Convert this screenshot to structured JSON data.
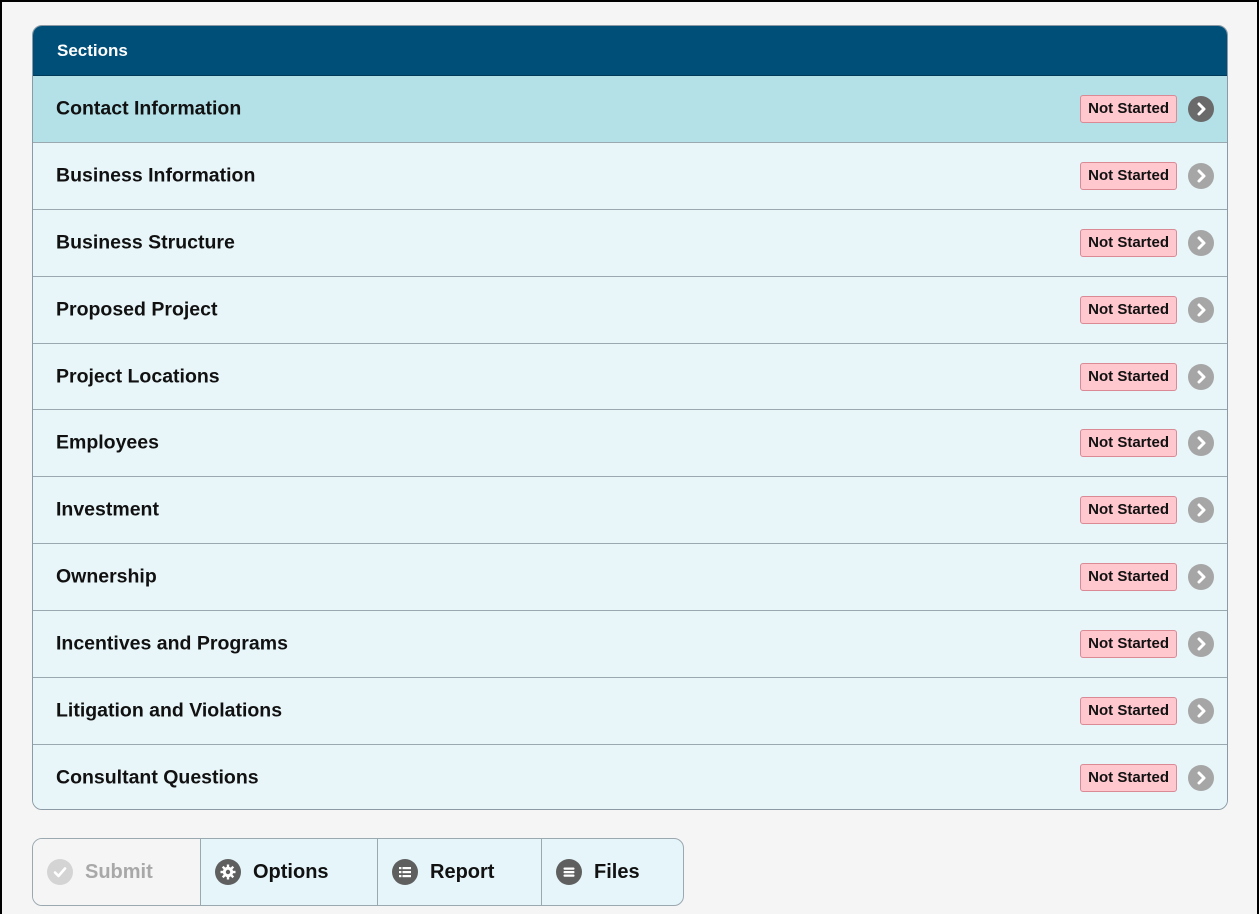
{
  "panel": {
    "title": "Sections",
    "rows": [
      {
        "label": "Contact Information",
        "status": "Not Started",
        "active": true
      },
      {
        "label": "Business Information",
        "status": "Not Started"
      },
      {
        "label": "Business Structure",
        "status": "Not Started"
      },
      {
        "label": "Proposed Project",
        "status": "Not Started"
      },
      {
        "label": "Project Locations",
        "status": "Not Started"
      },
      {
        "label": "Employees",
        "status": "Not Started"
      },
      {
        "label": "Investment",
        "status": "Not Started"
      },
      {
        "label": "Ownership",
        "status": "Not Started"
      },
      {
        "label": "Incentives and Programs",
        "status": "Not Started"
      },
      {
        "label": "Litigation and Violations",
        "status": "Not Started"
      },
      {
        "label": "Consultant Questions",
        "status": "Not Started"
      }
    ]
  },
  "toolbar": {
    "submit_label": "Submit",
    "options_label": "Options",
    "report_label": "Report",
    "files_label": "Files"
  },
  "icons": {
    "row_arrow": "chevron-right-icon",
    "submit": "check-icon",
    "options": "gear-icon",
    "report": "list-icon",
    "files": "menu-icon"
  },
  "colors": {
    "header_bg": "#004f79",
    "row_bg": "#e8f6fa",
    "row_active_bg": "#b4e0e8",
    "badge_bg": "#ffc7ce"
  }
}
